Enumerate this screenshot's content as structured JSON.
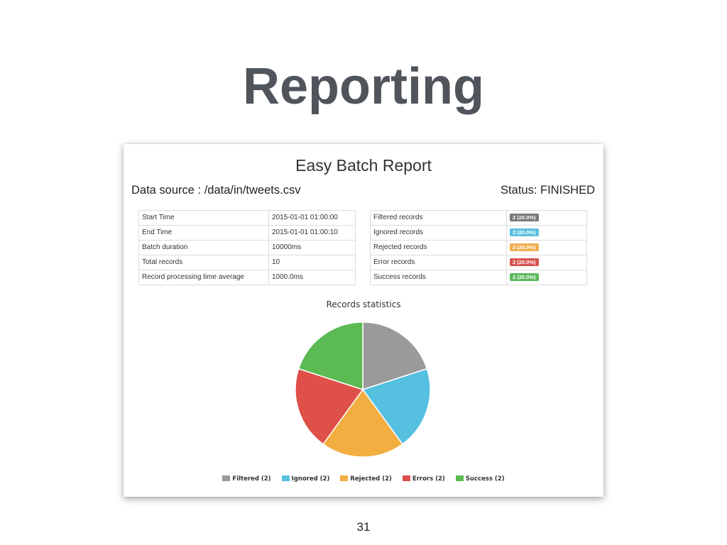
{
  "slide": {
    "title": "Reporting",
    "page_number": "31"
  },
  "report": {
    "title": "Easy Batch Report",
    "data_source": "Data source : /data/in/tweets.csv",
    "status": "Status: FINISHED",
    "summary": [
      {
        "label": "Start Time",
        "value": "2015-01-01 01:00:00"
      },
      {
        "label": "End Time",
        "value": "2015-01-01 01:00:10"
      },
      {
        "label": "Batch duration",
        "value": "10000ms"
      },
      {
        "label": "Total records",
        "value": "10"
      },
      {
        "label": "Record processing time average",
        "value": "1000.0ms"
      }
    ],
    "records": [
      {
        "label": "Filtered records",
        "badge": "2 (20.0%)",
        "color": "#777777"
      },
      {
        "label": "Ignored records",
        "badge": "2 (20.0%)",
        "color": "#5bc0de"
      },
      {
        "label": "Rejected records",
        "badge": "2 (20.0%)",
        "color": "#f0ad4e"
      },
      {
        "label": "Error records",
        "badge": "2 (20.0%)",
        "color": "#d9534f"
      },
      {
        "label": "Success records",
        "badge": "2 (20.0%)",
        "color": "#5cb85c"
      }
    ]
  },
  "chart_data": {
    "type": "pie",
    "title": "Records statistics",
    "legend_position": "bottom",
    "series": [
      {
        "name": "Filtered",
        "value": 2,
        "legend": "Filtered (2)",
        "color": "#9a9a9a"
      },
      {
        "name": "Ignored",
        "value": 2,
        "legend": "Ignored (2)",
        "color": "#55c0e0"
      },
      {
        "name": "Rejected",
        "value": 2,
        "legend": "Rejected (2)",
        "color": "#f2ae40"
      },
      {
        "name": "Errors",
        "value": 2,
        "legend": "Errors (2)",
        "color": "#de5048"
      },
      {
        "name": "Success",
        "value": 2,
        "legend": "Success (2)",
        "color": "#5cba54"
      }
    ]
  }
}
